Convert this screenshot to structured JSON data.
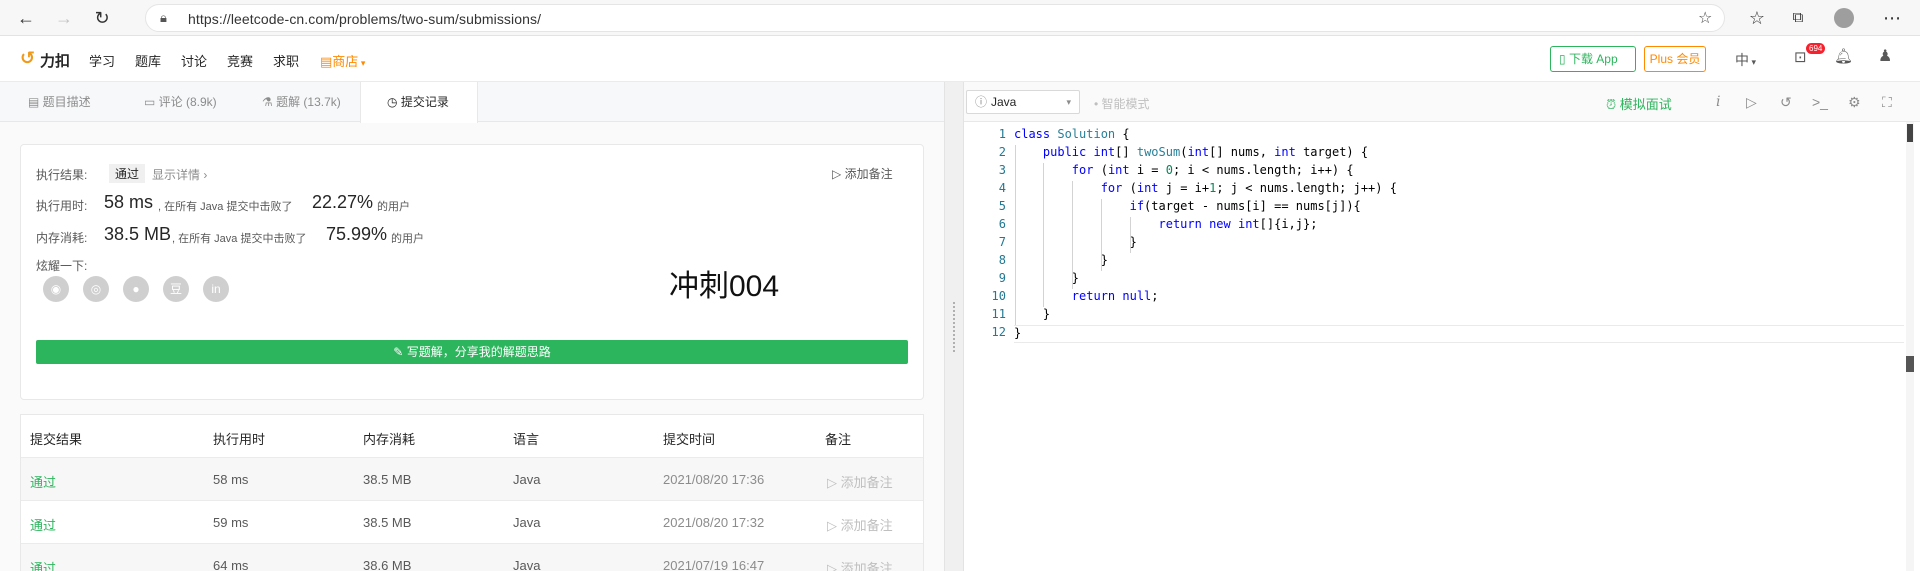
{
  "browser": {
    "url": "https://leetcode-cn.com/problems/two-sum/submissions/"
  },
  "header": {
    "logo_text": "力扣",
    "nav": [
      "学习",
      "题库",
      "讨论",
      "竞赛",
      "求职"
    ],
    "store_label": "商店",
    "download_label": "下载 App",
    "plus_label": "Plus 会员",
    "lang_label": "中",
    "notif_badge": "694"
  },
  "tabs": [
    {
      "label": "题目描述",
      "icon": "document-icon"
    },
    {
      "label": "评论 (8.9k)",
      "icon": "comment-icon"
    },
    {
      "label": "题解 (13.7k)",
      "icon": "flask-icon"
    },
    {
      "label": "提交记录",
      "icon": "clock-icon"
    }
  ],
  "result": {
    "exec_result_label": "执行结果:",
    "status": "通过",
    "details_label": "显示详情 ›",
    "add_note_label": "添加备注",
    "time_label": "执行用时:",
    "time_value": "58 ms",
    "time_mid": ", 在所有 Java 提交中击败了",
    "time_pct": "22.27%",
    "users_label": "的用户",
    "mem_label": "内存消耗:",
    "mem_value": "38.5 MB",
    "mem_mid": ", 在所有 Java 提交中击败了",
    "mem_pct": "75.99%",
    "share_label": "炫耀一下:",
    "overlay_text": "冲刺004",
    "write_solution_label": "写题解，分享我的解题思路"
  },
  "table": {
    "headers": [
      "提交结果",
      "执行用时",
      "内存消耗",
      "语言",
      "提交时间",
      "备注"
    ],
    "rows": [
      {
        "result": "通过",
        "time": "58 ms",
        "memory": "38.5 MB",
        "lang": "Java",
        "submitted": "2021/08/20 17:36",
        "note": "添加备注"
      },
      {
        "result": "通过",
        "time": "59 ms",
        "memory": "38.5 MB",
        "lang": "Java",
        "submitted": "2021/08/20 17:32",
        "note": "添加备注"
      },
      {
        "result": "通过",
        "time": "64 ms",
        "memory": "38.6 MB",
        "lang": "Java",
        "submitted": "2021/07/19 16:47",
        "note": "添加备注"
      }
    ]
  },
  "editor": {
    "language": "Java",
    "smart_mode": "智能模式",
    "mock_interview": "模拟面试",
    "line_numbers": [
      "1",
      "2",
      "3",
      "4",
      "5",
      "6",
      "7",
      "8",
      "9",
      "10",
      "11",
      "12"
    ]
  }
}
